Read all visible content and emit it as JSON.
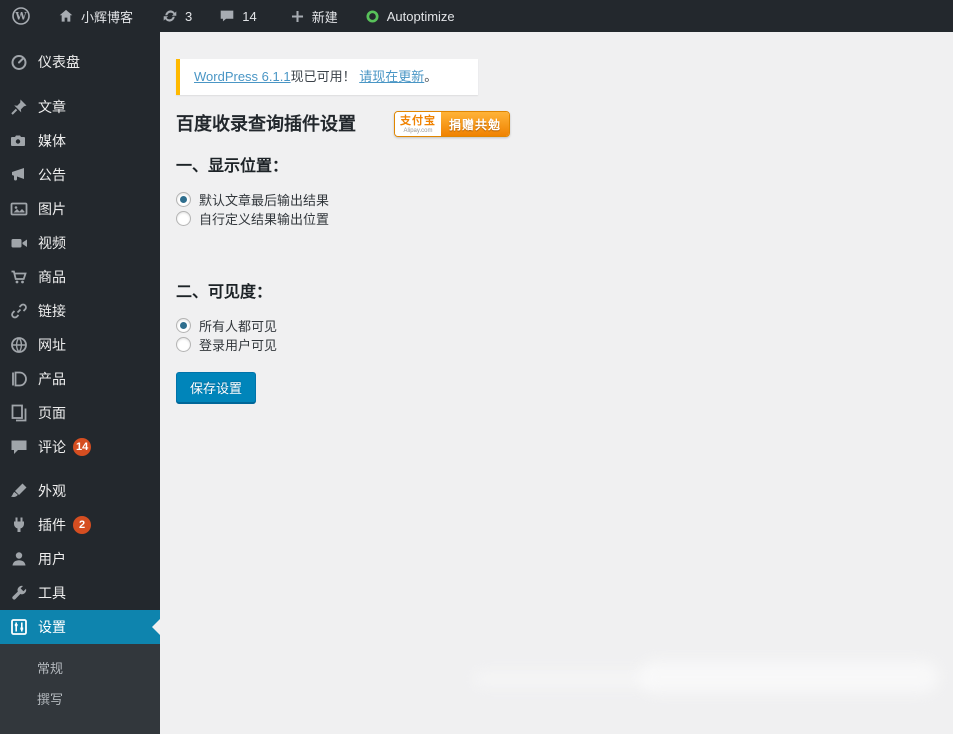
{
  "admin_bar": {
    "site_name": "小辉博客",
    "updates_count": "3",
    "comments_count": "14",
    "new_label": "新建",
    "autoptimize_label": "Autoptimize"
  },
  "sidebar": {
    "items": [
      {
        "label": "仪表盘",
        "icon": "dashboard-icon"
      },
      {
        "label": "文章",
        "icon": "posts-icon"
      },
      {
        "label": "媒体",
        "icon": "media-icon"
      },
      {
        "label": "公告",
        "icon": "announcement-icon"
      },
      {
        "label": "图片",
        "icon": "image-icon"
      },
      {
        "label": "视频",
        "icon": "video-icon"
      },
      {
        "label": "商品",
        "icon": "cart-icon"
      },
      {
        "label": "链接",
        "icon": "link-icon"
      },
      {
        "label": "网址",
        "icon": "globe-icon"
      },
      {
        "label": "产品",
        "icon": "product-icon"
      },
      {
        "label": "页面",
        "icon": "pages-icon"
      },
      {
        "label": "评论",
        "icon": "comments-icon",
        "badge": "14"
      },
      {
        "label": "外观",
        "icon": "appearance-icon"
      },
      {
        "label": "插件",
        "icon": "plugins-icon",
        "badge": "2"
      },
      {
        "label": "用户",
        "icon": "users-icon"
      },
      {
        "label": "工具",
        "icon": "tools-icon"
      },
      {
        "label": "设置",
        "icon": "settings-icon",
        "selected": true
      }
    ],
    "submenu": [
      "常规",
      "撰写"
    ]
  },
  "notice": {
    "link1": "WordPress 6.1.1",
    "text1": "现已可用！",
    "link2": "请现在更新",
    "text2": "。"
  },
  "main": {
    "title": "百度收录查询插件设置",
    "donate": {
      "brand": "支付宝",
      "brand_sub": "Alipay.com",
      "label": "捐赠共勉"
    },
    "sections": [
      {
        "heading": "一、显示位置：",
        "options": [
          {
            "label": "默认文章最后输出结果",
            "checked": true
          },
          {
            "label": "自行定义结果输出位置",
            "checked": false
          }
        ]
      },
      {
        "heading": "二、可见度：",
        "options": [
          {
            "label": "所有人都可见",
            "checked": true
          },
          {
            "label": "登录用户可见",
            "checked": false
          }
        ]
      }
    ],
    "save_button": "保存设置"
  },
  "colors": {
    "admin_dark": "#23282d",
    "selected_menu": "#0e84ae",
    "badge": "#d54e21",
    "notice_border": "#ffb900",
    "link": "#4a96c5",
    "primary_button": "#0085ba",
    "donate_orange": "#f08200",
    "content_bg": "#f0f0f1"
  }
}
